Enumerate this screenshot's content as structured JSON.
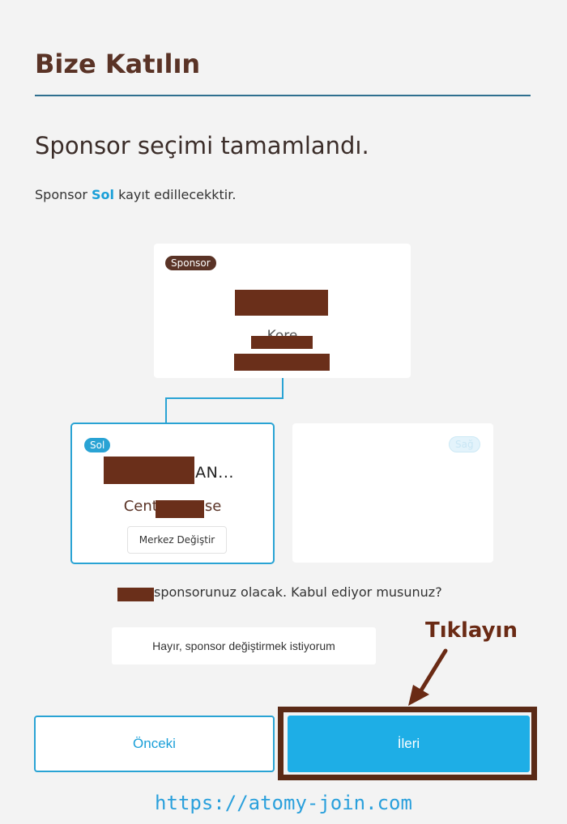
{
  "header": {
    "title": "Bize Katılın"
  },
  "page": {
    "title": "Sponsor seçimi tamamlandı.",
    "info_prefix": "Sponsor ",
    "info_side": "Sol",
    "info_suffix": " kayıt edillecekktir."
  },
  "sponsor_card": {
    "badge": "Sponsor",
    "country": "Kore"
  },
  "left_card": {
    "badge": "Sol",
    "name_visible": "AN...",
    "center_prefix": "Cent",
    "center_suffix": "se",
    "change_button": "Merkez Değiştir"
  },
  "right_card": {
    "badge": "Sağ"
  },
  "confirm": {
    "text": "sponsorunuz olacak. Kabul ediyor musunuz?",
    "no_button": "Hayır, sponsor değiştirmek istiyorum"
  },
  "annotation": {
    "label": "Tıklayın"
  },
  "footer": {
    "prev_button": "Önceki",
    "next_button": "İleri"
  },
  "watermark": "https://atomy-join.com",
  "colors": {
    "accent": "#29a3d4",
    "brand_brown": "#5a3326",
    "primary_button": "#1eaee6"
  }
}
